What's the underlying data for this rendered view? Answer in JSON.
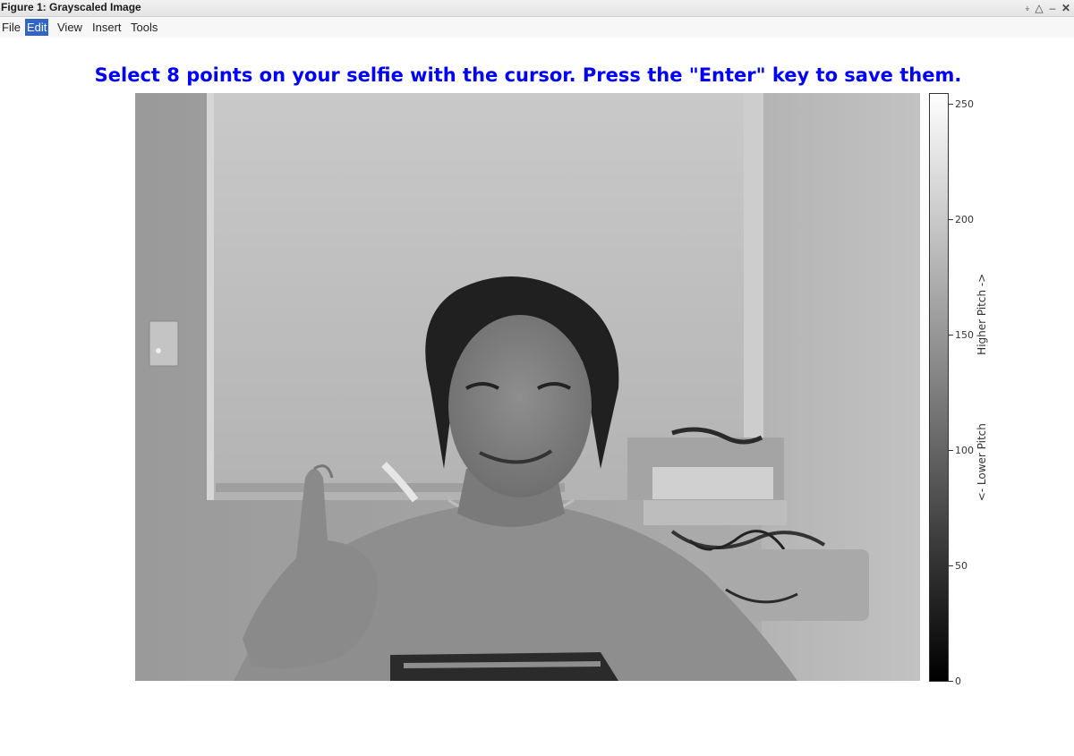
{
  "window": {
    "title": "Figure 1: Grayscaled Image",
    "controls": {
      "pin": "⍖",
      "restore": "△",
      "minimize": "–",
      "close": "✕"
    }
  },
  "menubar": {
    "items": [
      {
        "label": "File",
        "active": false
      },
      {
        "label": "Edit",
        "active": true
      },
      {
        "label": "View",
        "active": false
      },
      {
        "label": "Insert",
        "active": false
      },
      {
        "label": "Tools",
        "active": false
      }
    ]
  },
  "figure": {
    "title": "Select 8 points on your selfie with the cursor. Press the \"Enter\" key to save them.",
    "title_color": "#0000ff"
  },
  "colorbar": {
    "range": [
      0,
      255
    ],
    "ticks": [
      "0",
      "50",
      "100",
      "150",
      "200",
      "250"
    ],
    "label": "<- Lower Pitch                    Higher Pitch ->",
    "colormap": "gray"
  }
}
